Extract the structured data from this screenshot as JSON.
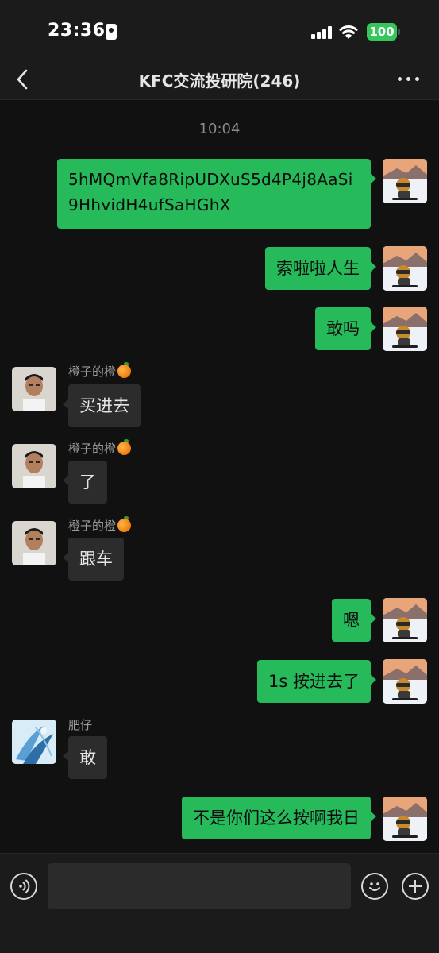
{
  "status_bar": {
    "time": "23:36",
    "battery": "100"
  },
  "nav": {
    "title": "KFC交流投研院(246)"
  },
  "chat": {
    "timestamp": "10:04",
    "messages": [
      {
        "direction": "out",
        "text": "5hMQmVfa8RipUDXuS5d4P4j8AaSi9HhvidH4ufSaHGhX"
      },
      {
        "direction": "out",
        "text": "索啦啦人生"
      },
      {
        "direction": "out",
        "text": "敢吗"
      },
      {
        "direction": "in",
        "sender": "橙子的橙",
        "text": "买进去"
      },
      {
        "direction": "in",
        "sender": "橙子的橙",
        "text": "了"
      },
      {
        "direction": "in",
        "sender": "橙子的橙",
        "text": "跟车"
      },
      {
        "direction": "out",
        "text": "嗯"
      },
      {
        "direction": "out",
        "text": "1s 按进去了"
      },
      {
        "direction": "in",
        "sender": "肥仔",
        "text": "敢"
      },
      {
        "direction": "out",
        "text": "不是你们这么按啊我日"
      }
    ]
  },
  "icons": {
    "back": "chevron-left-icon",
    "more": "more-dots-icon",
    "sender_badge": "orange-icon",
    "voice": "voice-icon",
    "emoji": "emoji-icon",
    "plus": "plus-icon"
  },
  "colors": {
    "outgoing_bubble": "#26ba5b",
    "incoming_bubble": "#2c2c2c",
    "background": "#111111",
    "bar": "#1b1b1b"
  }
}
